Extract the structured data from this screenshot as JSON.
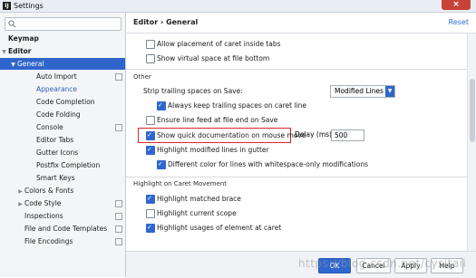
{
  "window": {
    "title": "Settings"
  },
  "sidebar": {
    "items": [
      {
        "label": "Keymap",
        "level": 0
      },
      {
        "label": "Editor",
        "level": 0
      },
      {
        "label": "General",
        "level": 1
      },
      {
        "label": "Auto Import",
        "level": 2
      },
      {
        "label": "Appearance",
        "level": 2
      },
      {
        "label": "Code Completion",
        "level": 2
      },
      {
        "label": "Code Folding",
        "level": 2
      },
      {
        "label": "Console",
        "level": 2
      },
      {
        "label": "Editor Tabs",
        "level": 2
      },
      {
        "label": "Gutter Icons",
        "level": 2
      },
      {
        "label": "Postfix Completion",
        "level": 2
      },
      {
        "label": "Smart Keys",
        "level": 2
      },
      {
        "label": "Colors & Fonts",
        "level": 1
      },
      {
        "label": "Code Style",
        "level": 1
      },
      {
        "label": "Inspections",
        "level": 1
      },
      {
        "label": "File and Code Templates",
        "level": 1
      },
      {
        "label": "File Encodings",
        "level": 1
      }
    ]
  },
  "header": {
    "breadcrumb": "Editor › General",
    "reset": "Reset"
  },
  "options": {
    "caret_inside_tabs": "Allow placement of caret inside tabs",
    "virtual_space": "Show virtual space at file bottom",
    "other_section": "Other",
    "strip_label": "Strip trailing spaces on Save:",
    "strip_value": "Modified Lines",
    "keep_trailing": "Always keep trailing spaces on caret line",
    "ensure_line_feed": "Ensure line feed at file end on Save",
    "quick_doc": "Show quick documentation on mouse move",
    "delay_label": "Delay (ms):",
    "delay_value": "500",
    "highlight_modified": "Highlight modified lines in gutter",
    "different_color": "Different color for lines with whitespace-only modifications",
    "caret_section": "Highlight on Caret Movement",
    "matched_brace": "Highlight matched brace",
    "current_scope": "Highlight current scope",
    "usages": "Highlight usages of element at caret"
  },
  "footer": {
    "ok": "OK",
    "cancel": "Cancel",
    "apply": "Apply",
    "help": "Help"
  },
  "watermark": "https://blog.csdn.net/cysitaii"
}
